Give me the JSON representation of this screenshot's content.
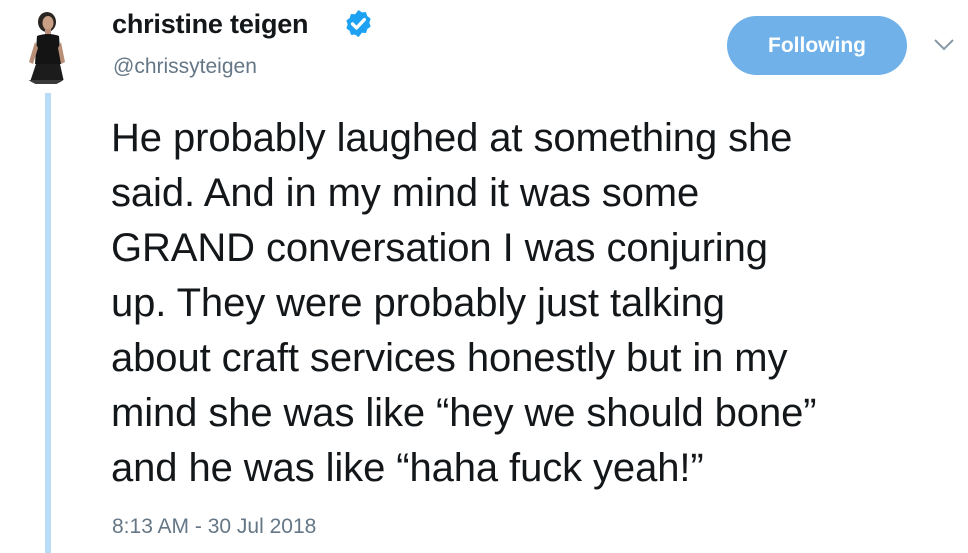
{
  "author": {
    "display_name": "christine teigen",
    "handle": "@chrissyteigen",
    "verified": true
  },
  "follow_button": {
    "label": "Following"
  },
  "menu": {
    "icon": "chevron-down-icon"
  },
  "tweet": {
    "lines": [
      "He probably laughed at something she",
      "said. And in my mind it was some",
      "GRAND conversation I was conjuring",
      "up. They were probably just talking",
      "about craft services honestly but in my",
      "mind she was like “hey we should bone”",
      "and he was like “haha fuck yeah!”"
    ],
    "timestamp": "8:13 AM - 30 Jul 2018"
  },
  "colors": {
    "accent": "#1da1f2",
    "button": "#6fb1e8",
    "thread_line": "#b9dcf7",
    "text": "#14171a",
    "secondary_text": "#657786"
  }
}
